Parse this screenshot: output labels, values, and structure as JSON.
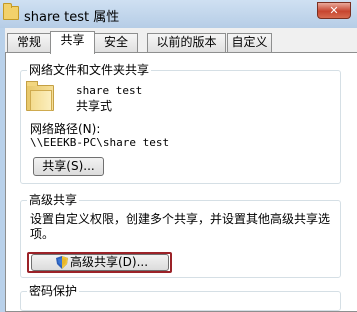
{
  "window": {
    "title": "share test 属性",
    "close_glyph": "✕"
  },
  "tabs": [
    {
      "label": "常规"
    },
    {
      "label": "共享"
    },
    {
      "label": "安全"
    },
    {
      "label": "以前的版本"
    },
    {
      "label": "自定义"
    }
  ],
  "network_sharing": {
    "group_label": "网络文件和文件夹共享",
    "folder_name": "share test",
    "status": "共享式",
    "path_label": "网络路径(N):",
    "path_value": "\\\\EEEKB-PC\\share test",
    "share_button": "共享(S)..."
  },
  "advanced_sharing": {
    "group_label": "高级共享",
    "description_line1": "设置自定义权限，创建多个共享，并设置其他高级共享选",
    "description_line2": "项。",
    "button_label": "高级共享(D)..."
  },
  "password_protection": {
    "group_label": "密码保护"
  },
  "colors": {
    "highlight_border": "#9b2228",
    "titlebar": "#b9d1ea",
    "close_button": "#c7452f"
  }
}
